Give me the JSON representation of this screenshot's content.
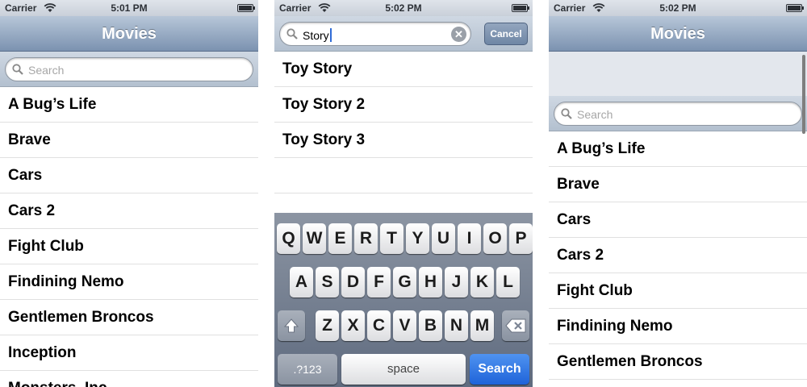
{
  "status": {
    "carrier": "Carrier",
    "screen1_time": "5:01 PM",
    "screen2_time": "5:02 PM",
    "screen3_time": "5:02 PM"
  },
  "nav": {
    "title": "Movies"
  },
  "search": {
    "placeholder": "Search",
    "query": "Story",
    "cancel_label": "Cancel"
  },
  "movies": [
    "A Bug’s Life",
    "Brave",
    "Cars",
    "Cars 2",
    "Fight Club",
    "Findining Nemo",
    "Gentlemen Broncos",
    "Inception",
    "Monsters, Inc"
  ],
  "results": [
    "Toy Story",
    "Toy Story 2",
    "Toy Story 3"
  ],
  "keyboard": {
    "row1": [
      "Q",
      "W",
      "E",
      "R",
      "T",
      "Y",
      "U",
      "I",
      "O",
      "P"
    ],
    "row2": [
      "A",
      "S",
      "D",
      "F",
      "G",
      "H",
      "J",
      "K",
      "L"
    ],
    "row3": [
      "Z",
      "X",
      "C",
      "V",
      "B",
      "N",
      "M"
    ],
    "numbers_label": ".?123",
    "space_label": "space",
    "search_label": "Search"
  },
  "colors": {
    "navbar": "#7b92b0",
    "search_key": "#1f63d9",
    "keyboard_bg": "#6f7a8c"
  }
}
